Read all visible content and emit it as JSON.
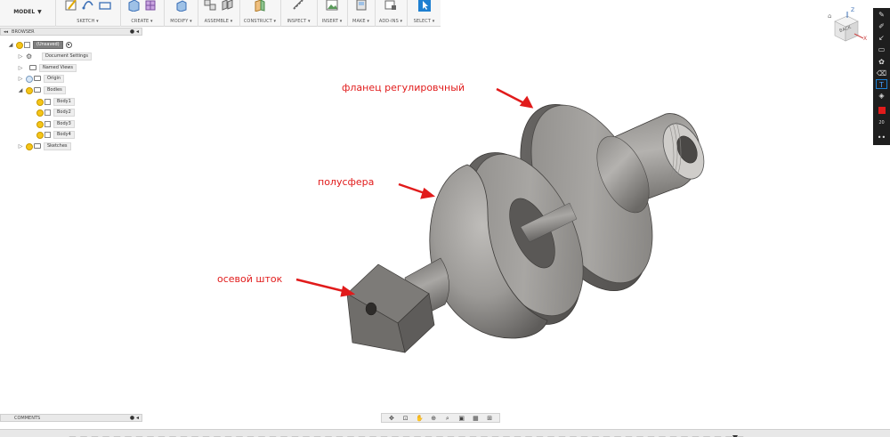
{
  "toolbar": {
    "model_label": "MODEL",
    "groups": [
      "SKETCH",
      "CREATE",
      "MODIFY",
      "ASSEMBLE",
      "CONSTRUCT",
      "INSPECT",
      "INSERT",
      "MAKE",
      "ADD-INS",
      "SELECT"
    ]
  },
  "browser": {
    "title": "BROWSER",
    "root_label": "(Unsaved)",
    "document_settings": "Document Settings",
    "named_views": "Named Views",
    "origin": "Origin",
    "bodies": "Bodies",
    "body1": "Body1",
    "body2": "Body2",
    "body3": "Body3",
    "body4": "Body4",
    "sketches": "Sketches"
  },
  "comments": {
    "title": "COMMENTS"
  },
  "viewcube": {
    "face_label": "BACK",
    "axis_z": "Z",
    "axis_x": "X"
  },
  "annotations": {
    "flange": "фланец регулировчный",
    "hemisphere": "полусфера",
    "shaft": "осевой шток"
  },
  "marker_toolbar": {
    "size_label": "20"
  },
  "colors": {
    "accent_select": "#1e7fd1",
    "annotation_red": "#e11b1b",
    "model_gray": "#8e8c8a",
    "marker_bg": "#1e1e1e"
  }
}
